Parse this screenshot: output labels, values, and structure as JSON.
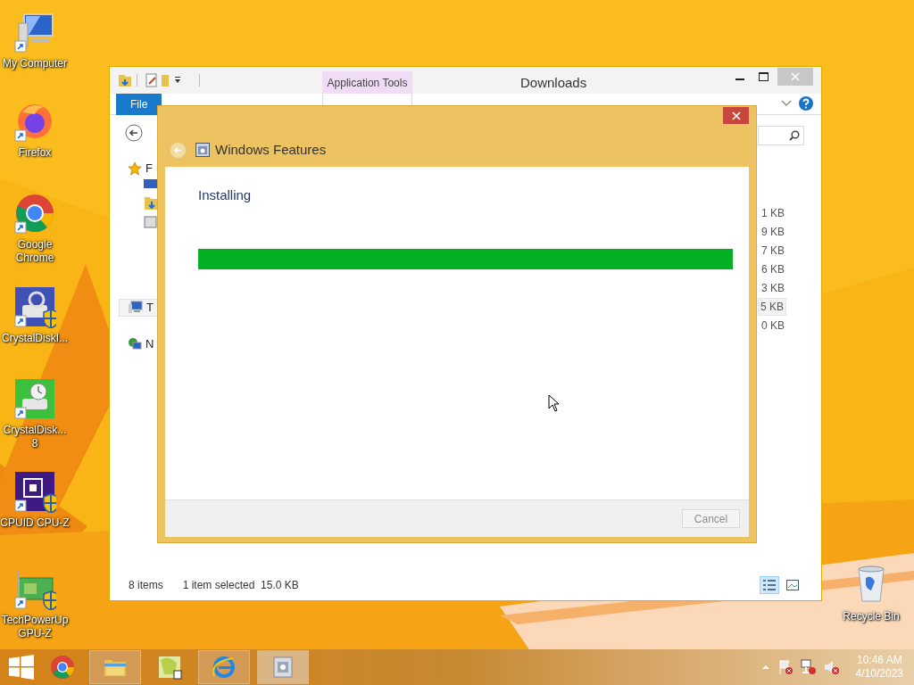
{
  "desktop": {
    "icons": [
      {
        "kind": "computer",
        "label": "My Computer"
      },
      {
        "kind": "firefox",
        "label": "Firefox"
      },
      {
        "kind": "chrome",
        "label": "Google\nChrome"
      },
      {
        "kind": "diskinfo",
        "label": "CrystalDiskI..."
      },
      {
        "kind": "diskmark",
        "label": "CrystalDisk...\n8"
      },
      {
        "kind": "cpuz",
        "label": "CPUID CPU-Z"
      },
      {
        "kind": "gpuz",
        "label": "TechPowerUp\nGPU-Z"
      }
    ],
    "recycle_bin": {
      "label": "Recycle Bin"
    }
  },
  "explorer": {
    "title": "Downloads",
    "context_tab": "Application Tools",
    "ribbon_tabs": [
      {
        "label": "File",
        "selected": true
      }
    ],
    "nav_items": [
      {
        "kind": "star",
        "label": "F",
        "selected": false
      },
      {
        "kind": "computer",
        "label": "T",
        "selected": true
      },
      {
        "kind": "network",
        "label": "N",
        "selected": false
      }
    ],
    "sizes": [
      {
        "text": "1 KB",
        "selected": false
      },
      {
        "text": "9 KB",
        "selected": false
      },
      {
        "text": "7 KB",
        "selected": false
      },
      {
        "text": "6 KB",
        "selected": false
      },
      {
        "text": "3 KB",
        "selected": false
      },
      {
        "text": "5 KB",
        "selected": true
      },
      {
        "text": "0 KB",
        "selected": false
      }
    ],
    "status_bar": {
      "count": "8 items",
      "selection": "1 item selected  15.0 KB"
    },
    "views": [
      {
        "kind": "details",
        "selected": true
      },
      {
        "kind": "large",
        "selected": false
      }
    ]
  },
  "dialog": {
    "title": "Windows Features",
    "heading": "Installing",
    "progress": {
      "level": 1
    },
    "cancel": {
      "label": "Cancel",
      "disabled": true
    }
  },
  "taskbar": {
    "apps": [
      {
        "kind": "chrome",
        "running": false,
        "selected": false
      },
      {
        "kind": "explorer",
        "running": true,
        "selected": false
      },
      {
        "kind": "viewer",
        "running": false,
        "selected": false
      },
      {
        "kind": "ie",
        "running": true,
        "selected": false
      },
      {
        "kind": "features",
        "running": true,
        "selected": true
      }
    ],
    "time": "10:46 AM",
    "date": "4/10/2023"
  }
}
